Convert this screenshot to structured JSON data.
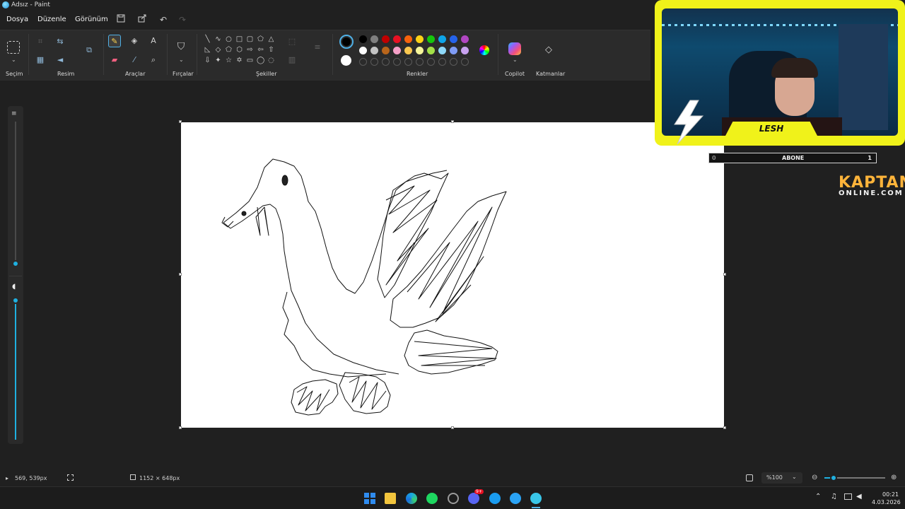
{
  "window": {
    "title": "Adsız - Paint"
  },
  "menu": {
    "items": [
      "Dosya",
      "Düzenle",
      "Görünüm"
    ]
  },
  "ribbon": {
    "groups": {
      "selection": "Seçim",
      "image": "Resim",
      "tools": "Araçlar",
      "brushes": "Fırçalar",
      "shapes": "Şekiller",
      "colors": "Renkler",
      "copilot": "Copilot",
      "layers": "Katmanlar"
    },
    "palette_row1": [
      "#000000",
      "#7f7f7f",
      "#c00000",
      "#e81123",
      "#f7630c",
      "#fcd116",
      "#16c60c",
      "#0ea5e9",
      "#2563eb",
      "#b146c2"
    ],
    "palette_row2": [
      "#ffffff",
      "#c3c3c3",
      "#b8651b",
      "#f6a0c8",
      "#f9c74f",
      "#f5f59a",
      "#a3e048",
      "#8ed8f8",
      "#7f9cf5",
      "#c8a2f0"
    ],
    "active_color": "#000000",
    "secondary_color": "#ffffff"
  },
  "statusbar": {
    "cursor_pos": "569, 539px",
    "canvas_size": "1152 × 648px",
    "zoom": "%100"
  },
  "taskbar": {
    "time": "00:21",
    "date": "4.03.2026",
    "discord_badge": "9+"
  },
  "overlay": {
    "streamer_name": "LESH",
    "sub_label": "ABONE",
    "sub_left": "0",
    "sub_right": "1",
    "brand_top": "KAPTAN",
    "brand_bottom": "ONLINE.COM"
  }
}
